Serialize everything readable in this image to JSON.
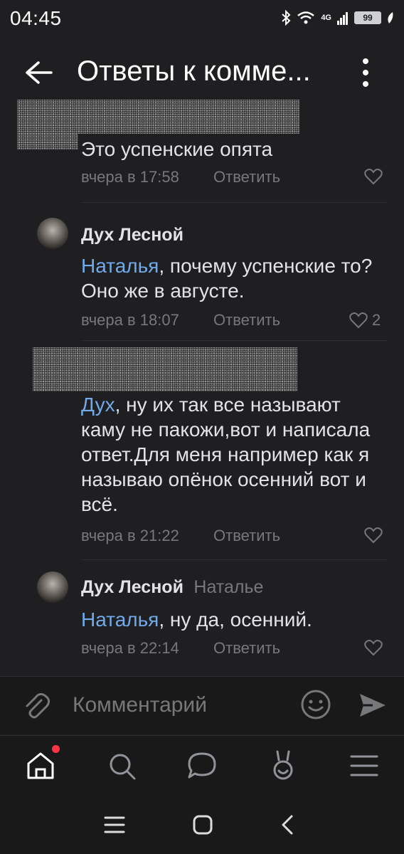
{
  "status_bar": {
    "time": "04:45",
    "battery": "99",
    "network": "4G"
  },
  "header": {
    "title": "Ответы к комме..."
  },
  "comments": [
    {
      "text": "Это успенские опята",
      "time": "вчера в 17:58",
      "reply_label": "Ответить",
      "likes": ""
    },
    {
      "author": "Дух Лесной",
      "mention": "Наталья",
      "text": ", почему успенские то? Оно же в августе.",
      "time": "вчера в 18:07",
      "reply_label": "Ответить",
      "likes": "2"
    },
    {
      "mention": "Дух",
      "text": ", ну их так все называют каму не пакожи,вот и написала ответ.Для меня например как я называю опёнок осенний вот и всё.",
      "time": "вчера в 21:22",
      "reply_label": "Ответить",
      "likes": ""
    },
    {
      "author": "Дух Лесной",
      "reply_to": "Наталье",
      "mention": "Наталья",
      "text": ", ну да, осенний.",
      "time": "вчера в 22:14",
      "reply_label": "Ответить",
      "likes": ""
    }
  ],
  "composer": {
    "placeholder": "Комментарий"
  },
  "tab_bar": {
    "items": [
      {
        "icon": "home-icon",
        "badge": true
      },
      {
        "icon": "search-icon"
      },
      {
        "icon": "messages-icon"
      },
      {
        "icon": "clips-icon"
      },
      {
        "icon": "menu-icon"
      }
    ]
  },
  "colors": {
    "background": "#1f1f21",
    "accent": "#71aaeb",
    "secondary_text": "#76787a",
    "badge": "#ff3347"
  }
}
